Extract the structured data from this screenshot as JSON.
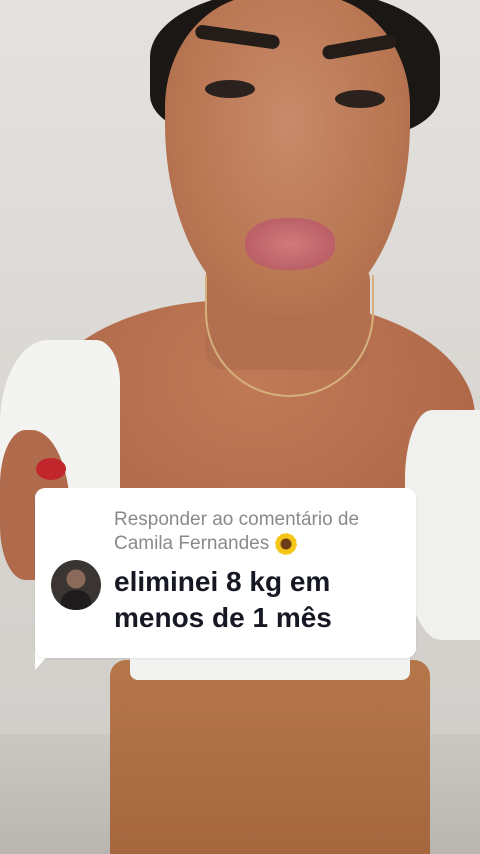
{
  "reply": {
    "header_prefix": "Responder ao comentário de",
    "commenter_name": "Camila Fernandes",
    "commenter_emoji": "sunflower-icon",
    "comment_text": "eliminei 8 kg em menos de 1 mês"
  },
  "colors": {
    "bubble_bg": "#ffffff",
    "header_text": "#8a8a8e",
    "comment_text": "#161823"
  }
}
